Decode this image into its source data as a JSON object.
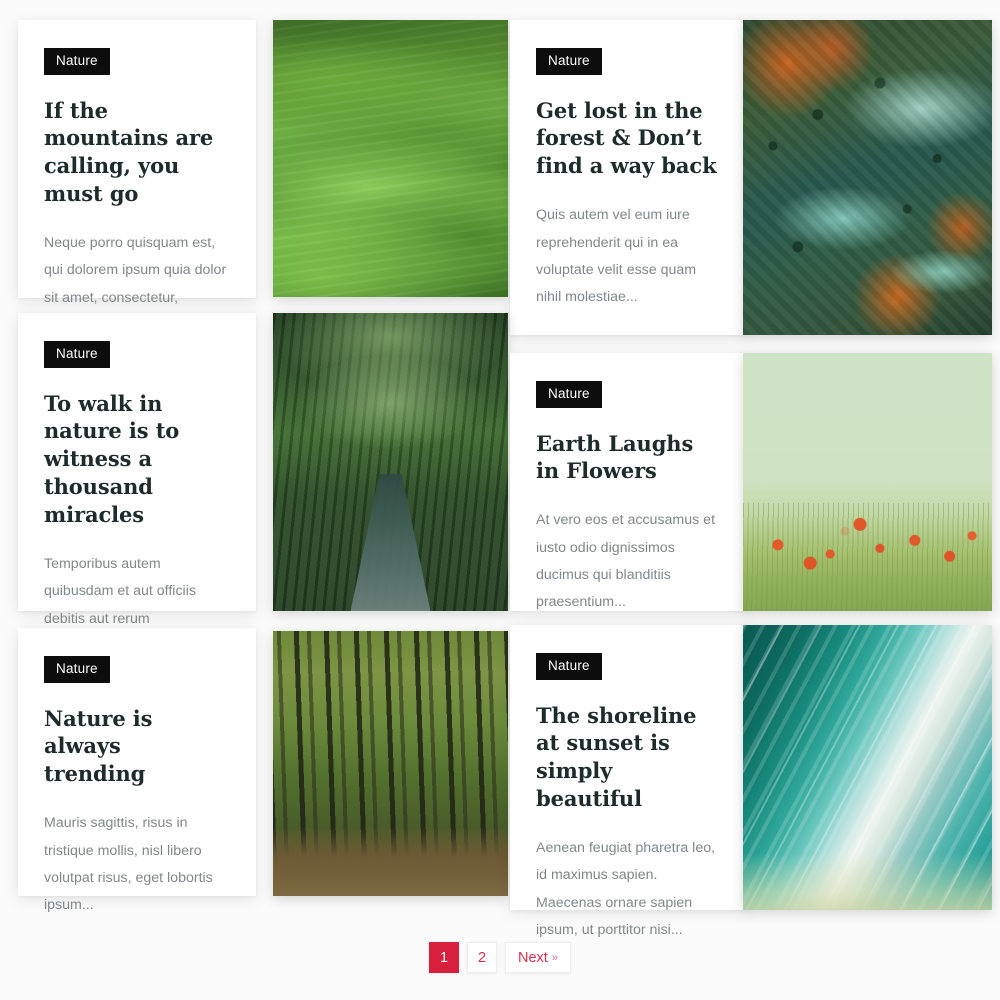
{
  "page": {
    "background_color": "#fbfbfb",
    "badge_bg": "#0d0d0d",
    "badge_fg": "#ffffff",
    "title_color": "#1d2b2b",
    "excerpt_color": "#82878b",
    "accent_color": "#d81f3e",
    "link_color": "#d9304c"
  },
  "cards": [
    {
      "category": "Nature",
      "title": "If the mountains are calling, you must go",
      "excerpt": "Neque porro quisquam est, qui dolorem ipsum quia dolor sit amet, consectetur, adipisci velit,...",
      "image_name": "green-rolling-hills-photo"
    },
    {
      "category": "Nature",
      "title": "Get lost in the forest & Don’t find a way back",
      "excerpt": "Quis autem vel eum iure reprehenderit qui in ea voluptate velit esse quam nihil molestiae...",
      "image_name": "aerial-forest-lakes-photo"
    },
    {
      "category": "Nature",
      "title": "To walk in nature is to witness a thousand miracles",
      "excerpt": "Temporibus autem quibusdam et aut officiis debitis aut rerum necessitatibus saepe eveniet ut et...",
      "image_name": "forest-footbridge-photo"
    },
    {
      "category": "Nature",
      "title": "Earth Laughs in Flowers",
      "excerpt": "At vero eos et accusamus et iusto odio dignissimos ducimus qui blanditiis praesentium...",
      "image_name": "poppy-meadow-photo"
    },
    {
      "category": "Nature",
      "title": "Nature is always trending",
      "excerpt": "Mauris sagittis, risus in tristique mollis, nisl libero volutpat risus, eget lobortis ipsum...",
      "image_name": "tall-forest-trail-photo"
    },
    {
      "category": "Nature",
      "title": "The shoreline at sunset is simply beautiful",
      "excerpt": "Aenean feugiat pharetra leo, id maximus sapien. Maecenas ornare sapien ipsum, ut porttitor nisi...",
      "image_name": "turquoise-shoreline-photo"
    }
  ],
  "pagination": {
    "current_page": "1",
    "pages": [
      "1",
      "2"
    ],
    "next_label": "Next",
    "next_chevron": "»"
  }
}
